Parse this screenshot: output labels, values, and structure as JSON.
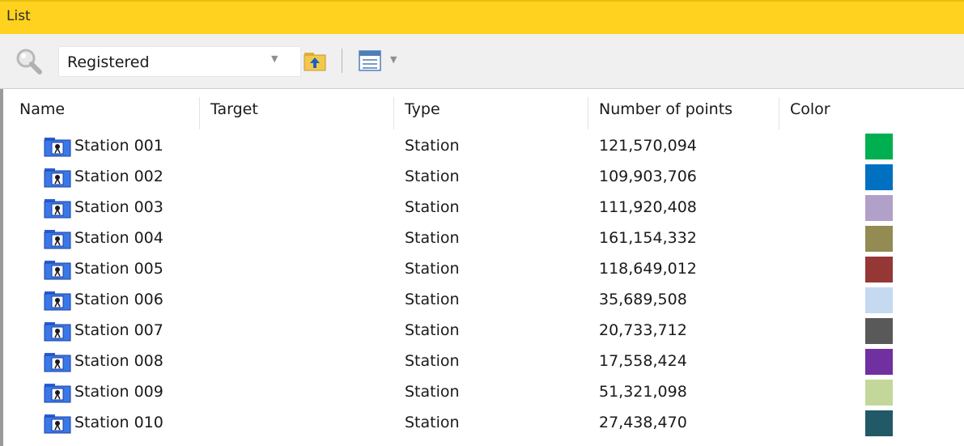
{
  "window": {
    "title": "List"
  },
  "toolbar": {
    "filter_value": "Registered",
    "icons": [
      "search-icon",
      "folder-up-icon",
      "view-options-icon"
    ]
  },
  "columns": [
    "Name",
    "Target",
    "Type",
    "Number of points",
    "Color"
  ],
  "rows": [
    {
      "name": "Station 001",
      "target": "",
      "type": "Station",
      "points": "121,570,094",
      "color": "#00b050"
    },
    {
      "name": "Station 002",
      "target": "",
      "type": "Station",
      "points": "109,903,706",
      "color": "#0070c0"
    },
    {
      "name": "Station 003",
      "target": "",
      "type": "Station",
      "points": "111,920,408",
      "color": "#b1a0c7"
    },
    {
      "name": "Station 004",
      "target": "",
      "type": "Station",
      "points": "161,154,332",
      "color": "#948a54"
    },
    {
      "name": "Station 005",
      "target": "",
      "type": "Station",
      "points": "118,649,012",
      "color": "#953735"
    },
    {
      "name": "Station 006",
      "target": "",
      "type": "Station",
      "points": "35,689,508",
      "color": "#c5d9f1"
    },
    {
      "name": "Station 007",
      "target": "",
      "type": "Station",
      "points": "20,733,712",
      "color": "#595959"
    },
    {
      "name": "Station 008",
      "target": "",
      "type": "Station",
      "points": "17,558,424",
      "color": "#7030a0"
    },
    {
      "name": "Station 009",
      "target": "",
      "type": "Station",
      "points": "51,321,098",
      "color": "#c4d79b"
    },
    {
      "name": "Station 010",
      "target": "",
      "type": "Station",
      "points": "27,438,470",
      "color": "#215967"
    }
  ]
}
